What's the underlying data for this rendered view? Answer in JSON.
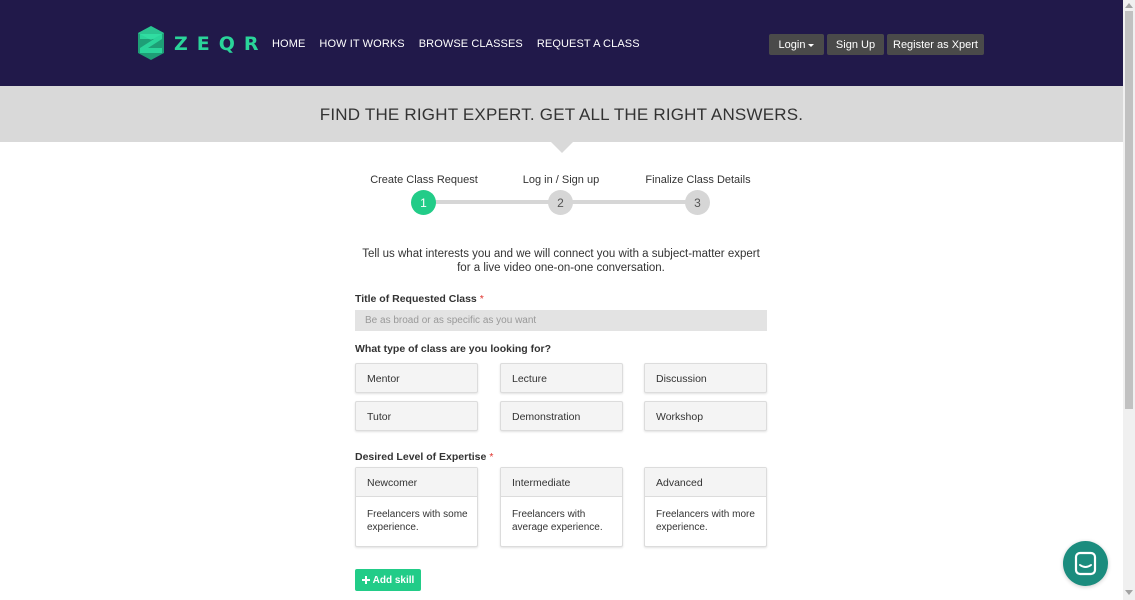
{
  "brand": {
    "name": "ZEQR",
    "accent": "#2ad49a",
    "header_bg": "#21194a"
  },
  "nav": {
    "items": [
      {
        "label": "HOME"
      },
      {
        "label": "HOW IT WORKS"
      },
      {
        "label": "BROWSE CLASSES"
      },
      {
        "label": "REQUEST A CLASS"
      }
    ]
  },
  "auth": {
    "login": "Login",
    "signup": "Sign Up",
    "register": "Register as Xpert"
  },
  "banner": {
    "title": "FIND THE RIGHT EXPERT. GET ALL THE RIGHT ANSWERS."
  },
  "steps": [
    {
      "label": "Create Class Request",
      "number": "1",
      "active": true
    },
    {
      "label": "Log in / Sign up",
      "number": "2",
      "active": false
    },
    {
      "label": "Finalize Class Details",
      "number": "3",
      "active": false
    }
  ],
  "intro": "Tell us what interests you and we will connect you with a subject-matter expert for a live video one-on-one conversation.",
  "form": {
    "title_label": "Title of Requested Class",
    "required_mark": "*",
    "title_placeholder": "Be as broad or as specific as you want",
    "type_label": "What type of class are you looking for?",
    "types": [
      "Mentor",
      "Lecture",
      "Discussion",
      "Tutor",
      "Demonstration",
      "Workshop"
    ],
    "level_label": "Desired Level of Expertise",
    "levels": [
      {
        "name": "Newcomer",
        "desc": "Freelancers with some experience."
      },
      {
        "name": "Intermediate",
        "desc": "Freelancers with average experience."
      },
      {
        "name": "Advanced",
        "desc": "Freelancers with more experience."
      }
    ],
    "add_skill": "Add skill",
    "add_skill_icon": "plus-icon"
  },
  "colors": {
    "active_step": "#22cc88",
    "button_green": "#22cc88",
    "chat_bg": "#1b8c7e",
    "required": "#e0322c"
  },
  "chat": {
    "icon": "chat-icon"
  }
}
